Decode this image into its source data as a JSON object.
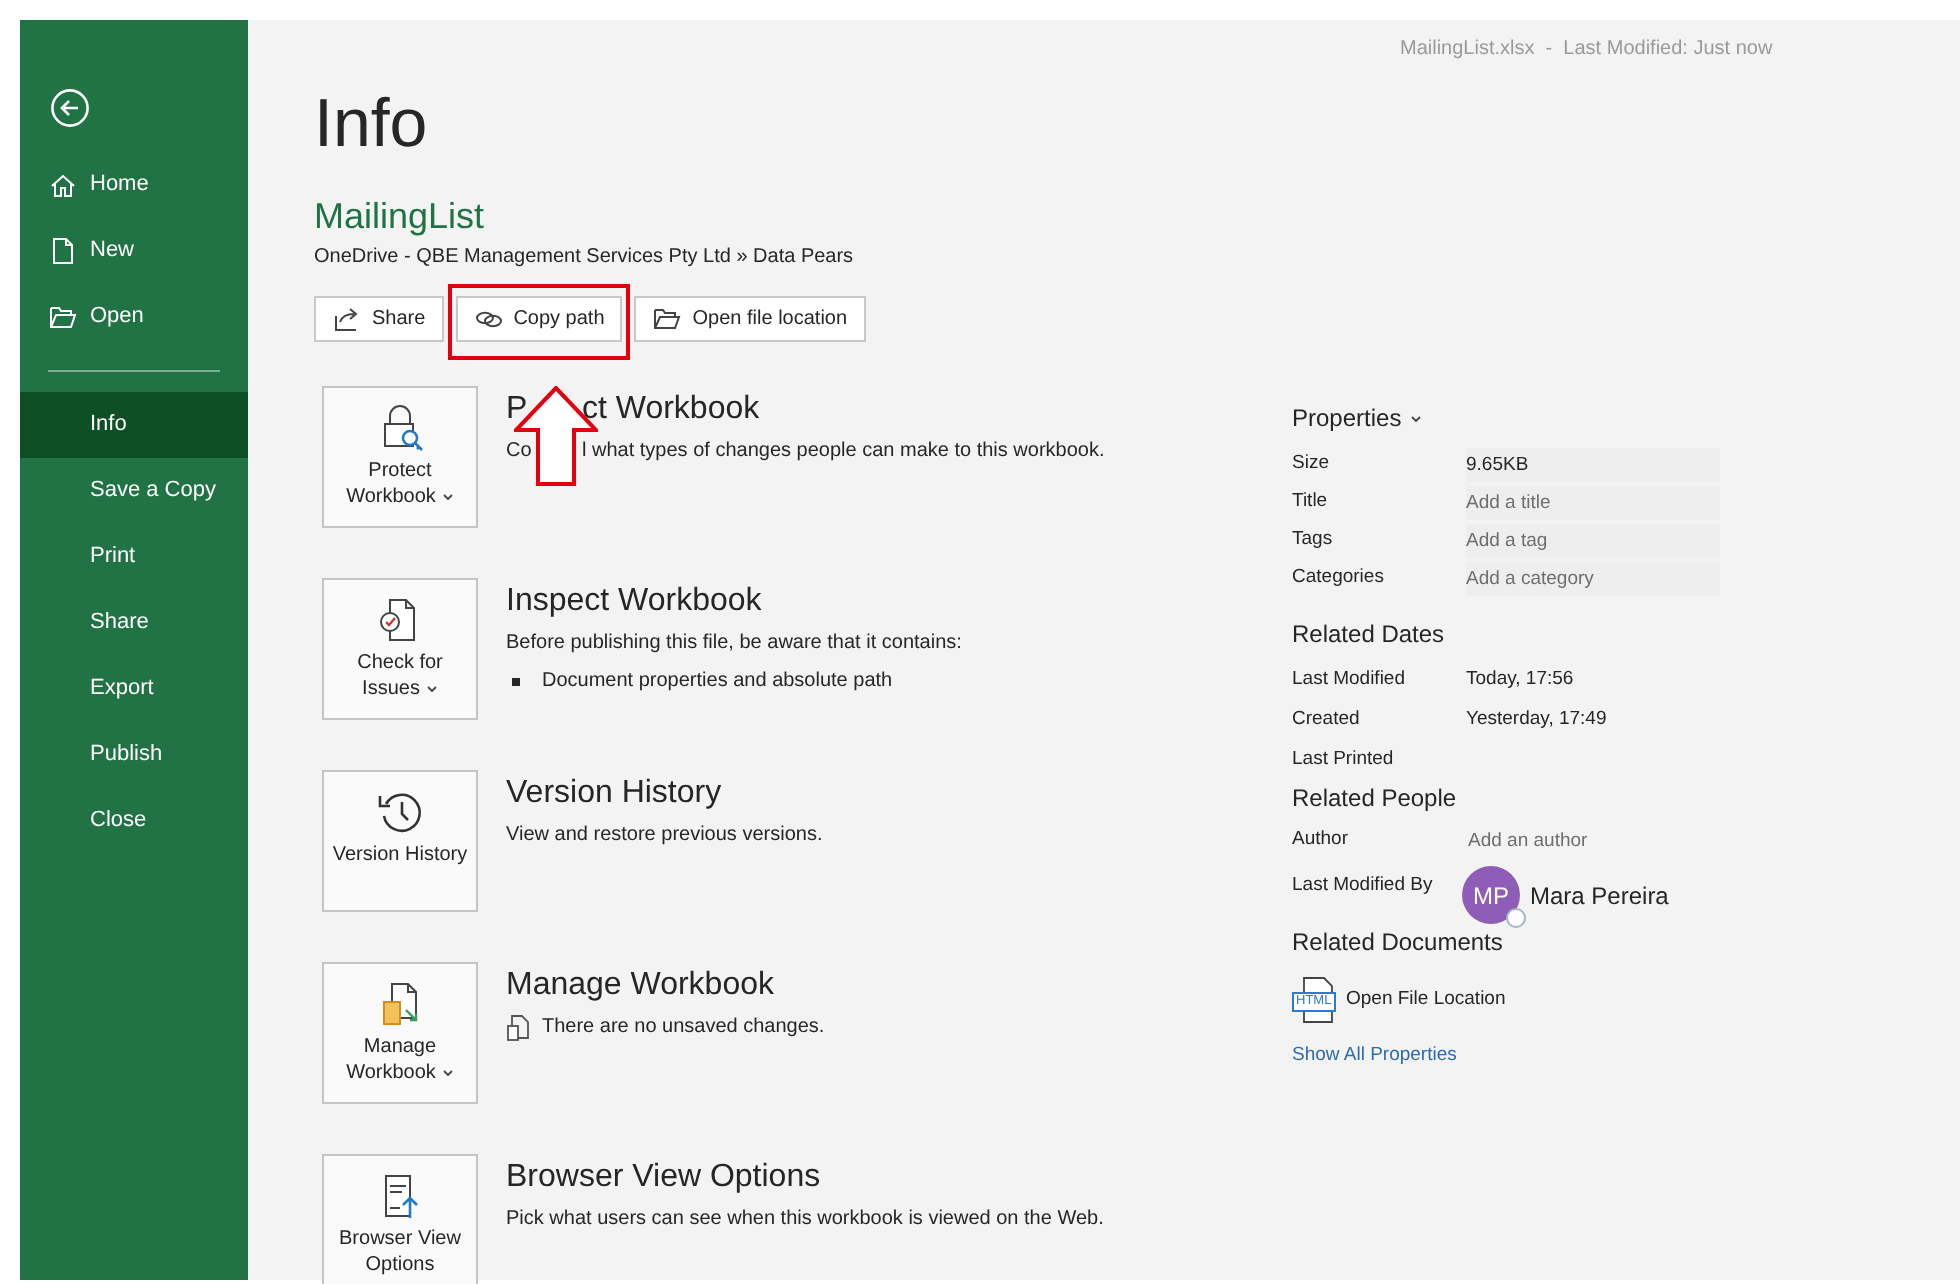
{
  "file_status": "MailingList.xlsx  -  Last Modified: Just now",
  "sidebar": {
    "primary_items": [
      {
        "label": "Home",
        "selected": false
      },
      {
        "label": "New",
        "selected": false
      },
      {
        "label": "Open",
        "selected": false
      }
    ],
    "secondary_items": [
      {
        "label": "Info",
        "selected": true
      },
      {
        "label": "Save a Copy",
        "selected": false
      },
      {
        "label": "Print",
        "selected": false
      },
      {
        "label": "Share",
        "selected": false
      },
      {
        "label": "Export",
        "selected": false
      },
      {
        "label": "Publish",
        "selected": false
      },
      {
        "label": "Close",
        "selected": false
      }
    ]
  },
  "page_title": "Info",
  "file_name": "MailingList",
  "file_path": "OneDrive - QBE Management Services Pty Ltd » Data Pears",
  "actions": [
    {
      "label": "Share",
      "highlighted": false
    },
    {
      "label": "Copy path",
      "highlighted": true
    },
    {
      "label": "Open file location",
      "highlighted": false
    }
  ],
  "sections": [
    {
      "kind": "covered",
      "button": "Protect Workbook",
      "dropdown": true,
      "title_parts": [
        "P",
        "ct Workbook"
      ],
      "description_parts": [
        "Co",
        "l what types of changes people can make to this workbook."
      ]
    },
    {
      "kind": "bullets",
      "button": "Check for Issues",
      "dropdown": true,
      "title": "Inspect Workbook",
      "description": "Before publishing this file, be aware that it contains:",
      "bullets": [
        "Document properties and absolute path"
      ]
    },
    {
      "kind": "text",
      "button": "Version History",
      "dropdown": false,
      "title": "Version History",
      "description": "View and restore previous versions."
    },
    {
      "kind": "note",
      "button": "Manage Workbook",
      "dropdown": true,
      "title": "Manage Workbook",
      "description": "There are no unsaved changes."
    },
    {
      "kind": "text",
      "button": "Browser View Options",
      "dropdown": false,
      "title": "Browser View Options",
      "description": "Pick what users can see when this workbook is viewed on the Web."
    }
  ],
  "properties": {
    "heading": "Properties",
    "rows": [
      {
        "label": "Size",
        "value": "9.65KB"
      },
      {
        "label": "Title",
        "placeholder": "Add a title"
      },
      {
        "label": "Tags",
        "placeholder": "Add a tag"
      },
      {
        "label": "Categories",
        "placeholder": "Add a category"
      }
    ]
  },
  "related_dates": {
    "heading": "Related Dates",
    "rows": [
      {
        "label": "Last Modified",
        "value": "Today, 17:56"
      },
      {
        "label": "Created",
        "value": "Yesterday, 17:49"
      },
      {
        "label": "Last Printed"
      }
    ]
  },
  "related_people": {
    "heading": "Related People",
    "author": {
      "label": "Author",
      "placeholder": "Add an author"
    },
    "last_modified_by": {
      "label": "Last Modified By",
      "initials": "MP",
      "name": "Mara Pereira"
    }
  },
  "related_documents": {
    "heading": "Related Documents",
    "icon_label": "HTML",
    "item": "Open File Location",
    "link": "Show All Properties"
  }
}
